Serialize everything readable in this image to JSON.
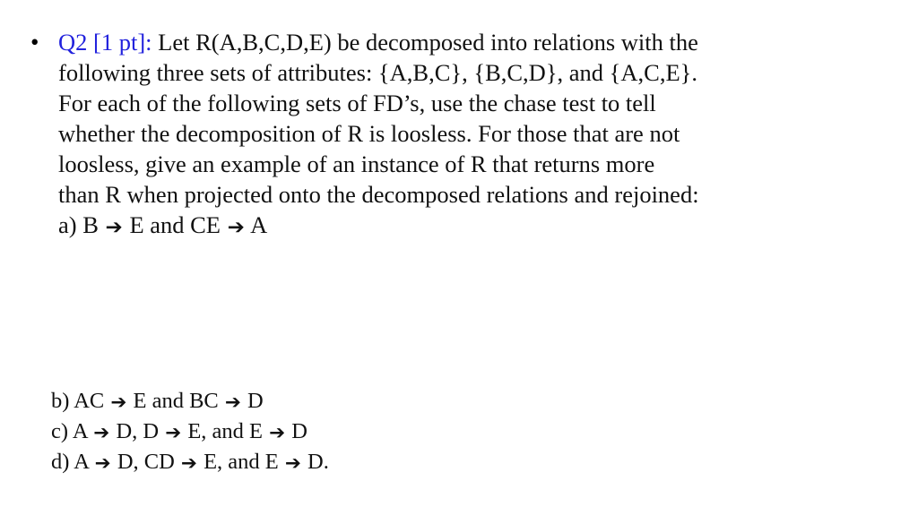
{
  "document": {
    "background_color": "#ffffff",
    "text_color": "#111111",
    "accent_color": "#2222dd",
    "bullet_glyph": "•",
    "arrow_glyph": "➔"
  },
  "question": {
    "label": "Q2 [1 pt]:",
    "lines": [
      {
        "id": "line-1",
        "prefix_label": "Q2 [1 pt]:",
        "text": " Let R(A,B,C,D,E) be decomposed into relations with the"
      },
      {
        "id": "line-2",
        "text": "following three sets of attributes: {A,B,C}, {B,C,D}, and {A,C,E}."
      },
      {
        "id": "line-3",
        "text": "For each of the following sets of FD’s, use the chase test to tell"
      },
      {
        "id": "line-4",
        "text": "whether the decomposition of R is loosless. For those that are not"
      },
      {
        "id": "line-5",
        "text": "loosless, give an example of an instance of R that returns more"
      },
      {
        "id": "line-6",
        "text": "than R when projected onto the decomposed relations and rejoined:"
      }
    ],
    "part_a": {
      "id": "part-a",
      "marker": "a)",
      "seg1": " B ",
      "arrow1": "➔",
      "seg2": " E and CE ",
      "arrow2": "➔",
      "seg3": " A"
    }
  },
  "subparts": [
    {
      "id": "part-b",
      "marker": "b)",
      "seg1": " AC ",
      "arrow1": "➔",
      "seg2": " E and BC ",
      "arrow2": "➔",
      "seg3": " D",
      "arrow3": "",
      "seg4": ""
    },
    {
      "id": "part-c",
      "marker": "c)",
      "seg1": " A ",
      "arrow1": "➔",
      "seg2": " D, D ",
      "arrow2": "➔",
      "seg3": " E, and E ",
      "arrow3": "➔",
      "seg4": " D"
    },
    {
      "id": "part-d",
      "marker": "d)",
      "seg1": " A ",
      "arrow1": "➔",
      "seg2": " D, CD ",
      "arrow2": "➔",
      "seg3": " E, and E ",
      "arrow3": "➔",
      "seg4": " D."
    }
  ]
}
